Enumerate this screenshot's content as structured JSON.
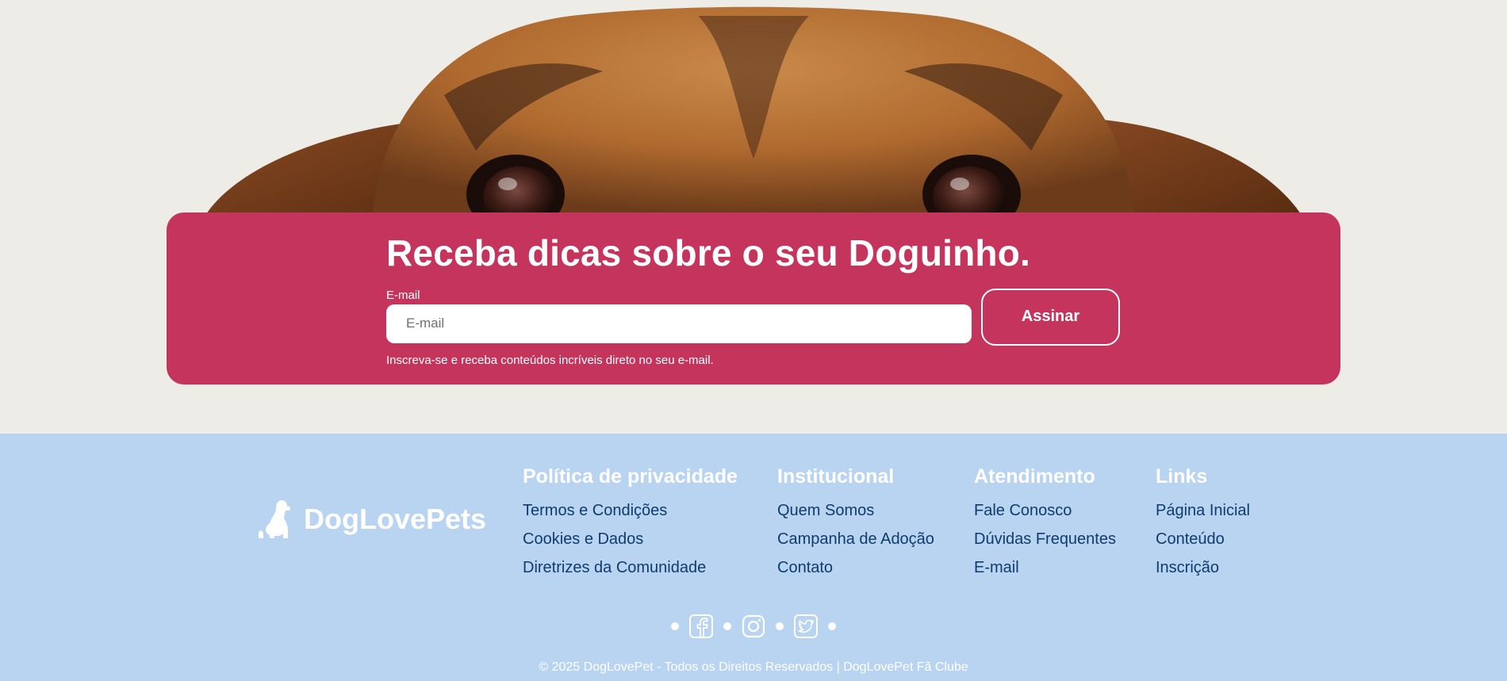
{
  "newsletter": {
    "title": "Receba dicas sobre o seu Doguinho.",
    "email_label": "E-mail",
    "email_placeholder": "E-mail",
    "email_value": "",
    "subscribe_label": "Assinar",
    "hint": "Inscreva-se e receba conteúdos incríveis direto no seu e-mail."
  },
  "brand": {
    "name": "DogLovePets",
    "icon": "dog-icon"
  },
  "footer": {
    "columns": [
      {
        "title": "Política de privacidade",
        "links": [
          "Termos e Condições",
          "Cookies e Dados",
          "Diretrizes da Comunidade"
        ]
      },
      {
        "title": "Institucional",
        "links": [
          "Quem Somos",
          "Campanha de Adoção",
          "Contato"
        ]
      },
      {
        "title": "Atendimento",
        "links": [
          "Fale Conosco",
          "Dúvidas Frequentes",
          "E-mail"
        ]
      },
      {
        "title": "Links",
        "links": [
          "Página Inicial",
          "Conteúdo",
          "Inscrição"
        ]
      }
    ],
    "social": [
      "facebook-icon",
      "instagram-icon",
      "twitter-icon"
    ],
    "copyright": "© 2025 DogLovePet - Todos os Direitos Reservados | DogLovePet Fã Clube"
  },
  "colors": {
    "background": "#edece6",
    "accent": "#c5345c",
    "footer_bg": "#b9d4f0",
    "footer_link": "#0f3c6e"
  }
}
